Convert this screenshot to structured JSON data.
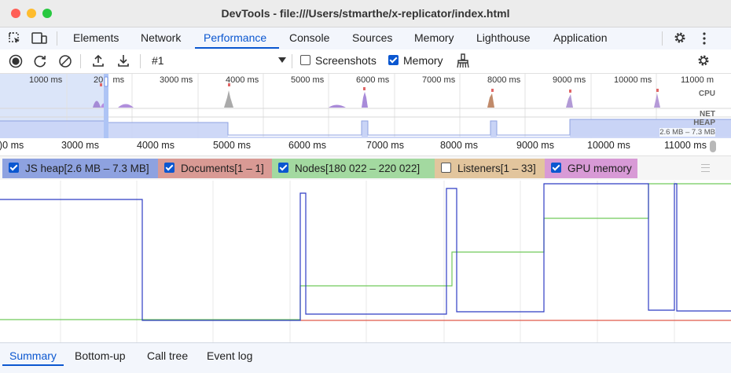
{
  "window": {
    "title": "DevTools - file:///Users/stmarthe/x-replicator/index.html"
  },
  "tabs": [
    {
      "label": "Elements"
    },
    {
      "label": "Network"
    },
    {
      "label": "Performance",
      "active": true
    },
    {
      "label": "Console"
    },
    {
      "label": "Sources"
    },
    {
      "label": "Memory"
    },
    {
      "label": "Lighthouse"
    },
    {
      "label": "Application"
    }
  ],
  "toolbar": {
    "recording_select": "#1",
    "screenshots_label": "Screenshots",
    "screenshots_checked": false,
    "memory_label": "Memory",
    "memory_checked": true
  },
  "overview": {
    "ticks": [
      "1000 ms",
      "20    ms",
      "3000 ms",
      "4000 ms",
      "5000 ms",
      "6000 ms",
      "7000 ms",
      "8000 ms",
      "9000 ms",
      "10000 ms",
      "11000 m"
    ],
    "cpu_label": "CPU",
    "net_label": "NET",
    "heap_label": "HEAP",
    "heap_range": "2.6 MB – 7.3 MB"
  },
  "ruler": {
    "ticks": [
      ")0 ms",
      "3000 ms",
      "4000 ms",
      "5000 ms",
      "6000 ms",
      "7000 ms",
      "8000 ms",
      "9000 ms",
      "10000 ms",
      "11000 ms"
    ]
  },
  "counters": [
    {
      "label": "JS heap[2.6 MB – 7.3 MB]",
      "checked": true,
      "color": "#8ea2e0"
    },
    {
      "label": "Documents[1 – 1]",
      "checked": true,
      "color": "#d99a94"
    },
    {
      "label": "Nodes[180 022 – 220 022]",
      "checked": true,
      "color": "#a3d9a0"
    },
    {
      "label": "Listeners[1 – 33]",
      "checked": false,
      "color": "#e2c59d"
    },
    {
      "label": "GPU memory",
      "checked": true,
      "color": "#d89ad6"
    }
  ],
  "bottom_tabs": [
    {
      "label": "Summary",
      "active": true
    },
    {
      "label": "Bottom-up"
    },
    {
      "label": "Call tree"
    },
    {
      "label": "Event log"
    }
  ],
  "colors": {
    "accent": "#0b57d0",
    "js_heap_line": "#2f3cc4",
    "nodes_line": "#72c95b",
    "documents_line": "#e05a4b"
  }
}
